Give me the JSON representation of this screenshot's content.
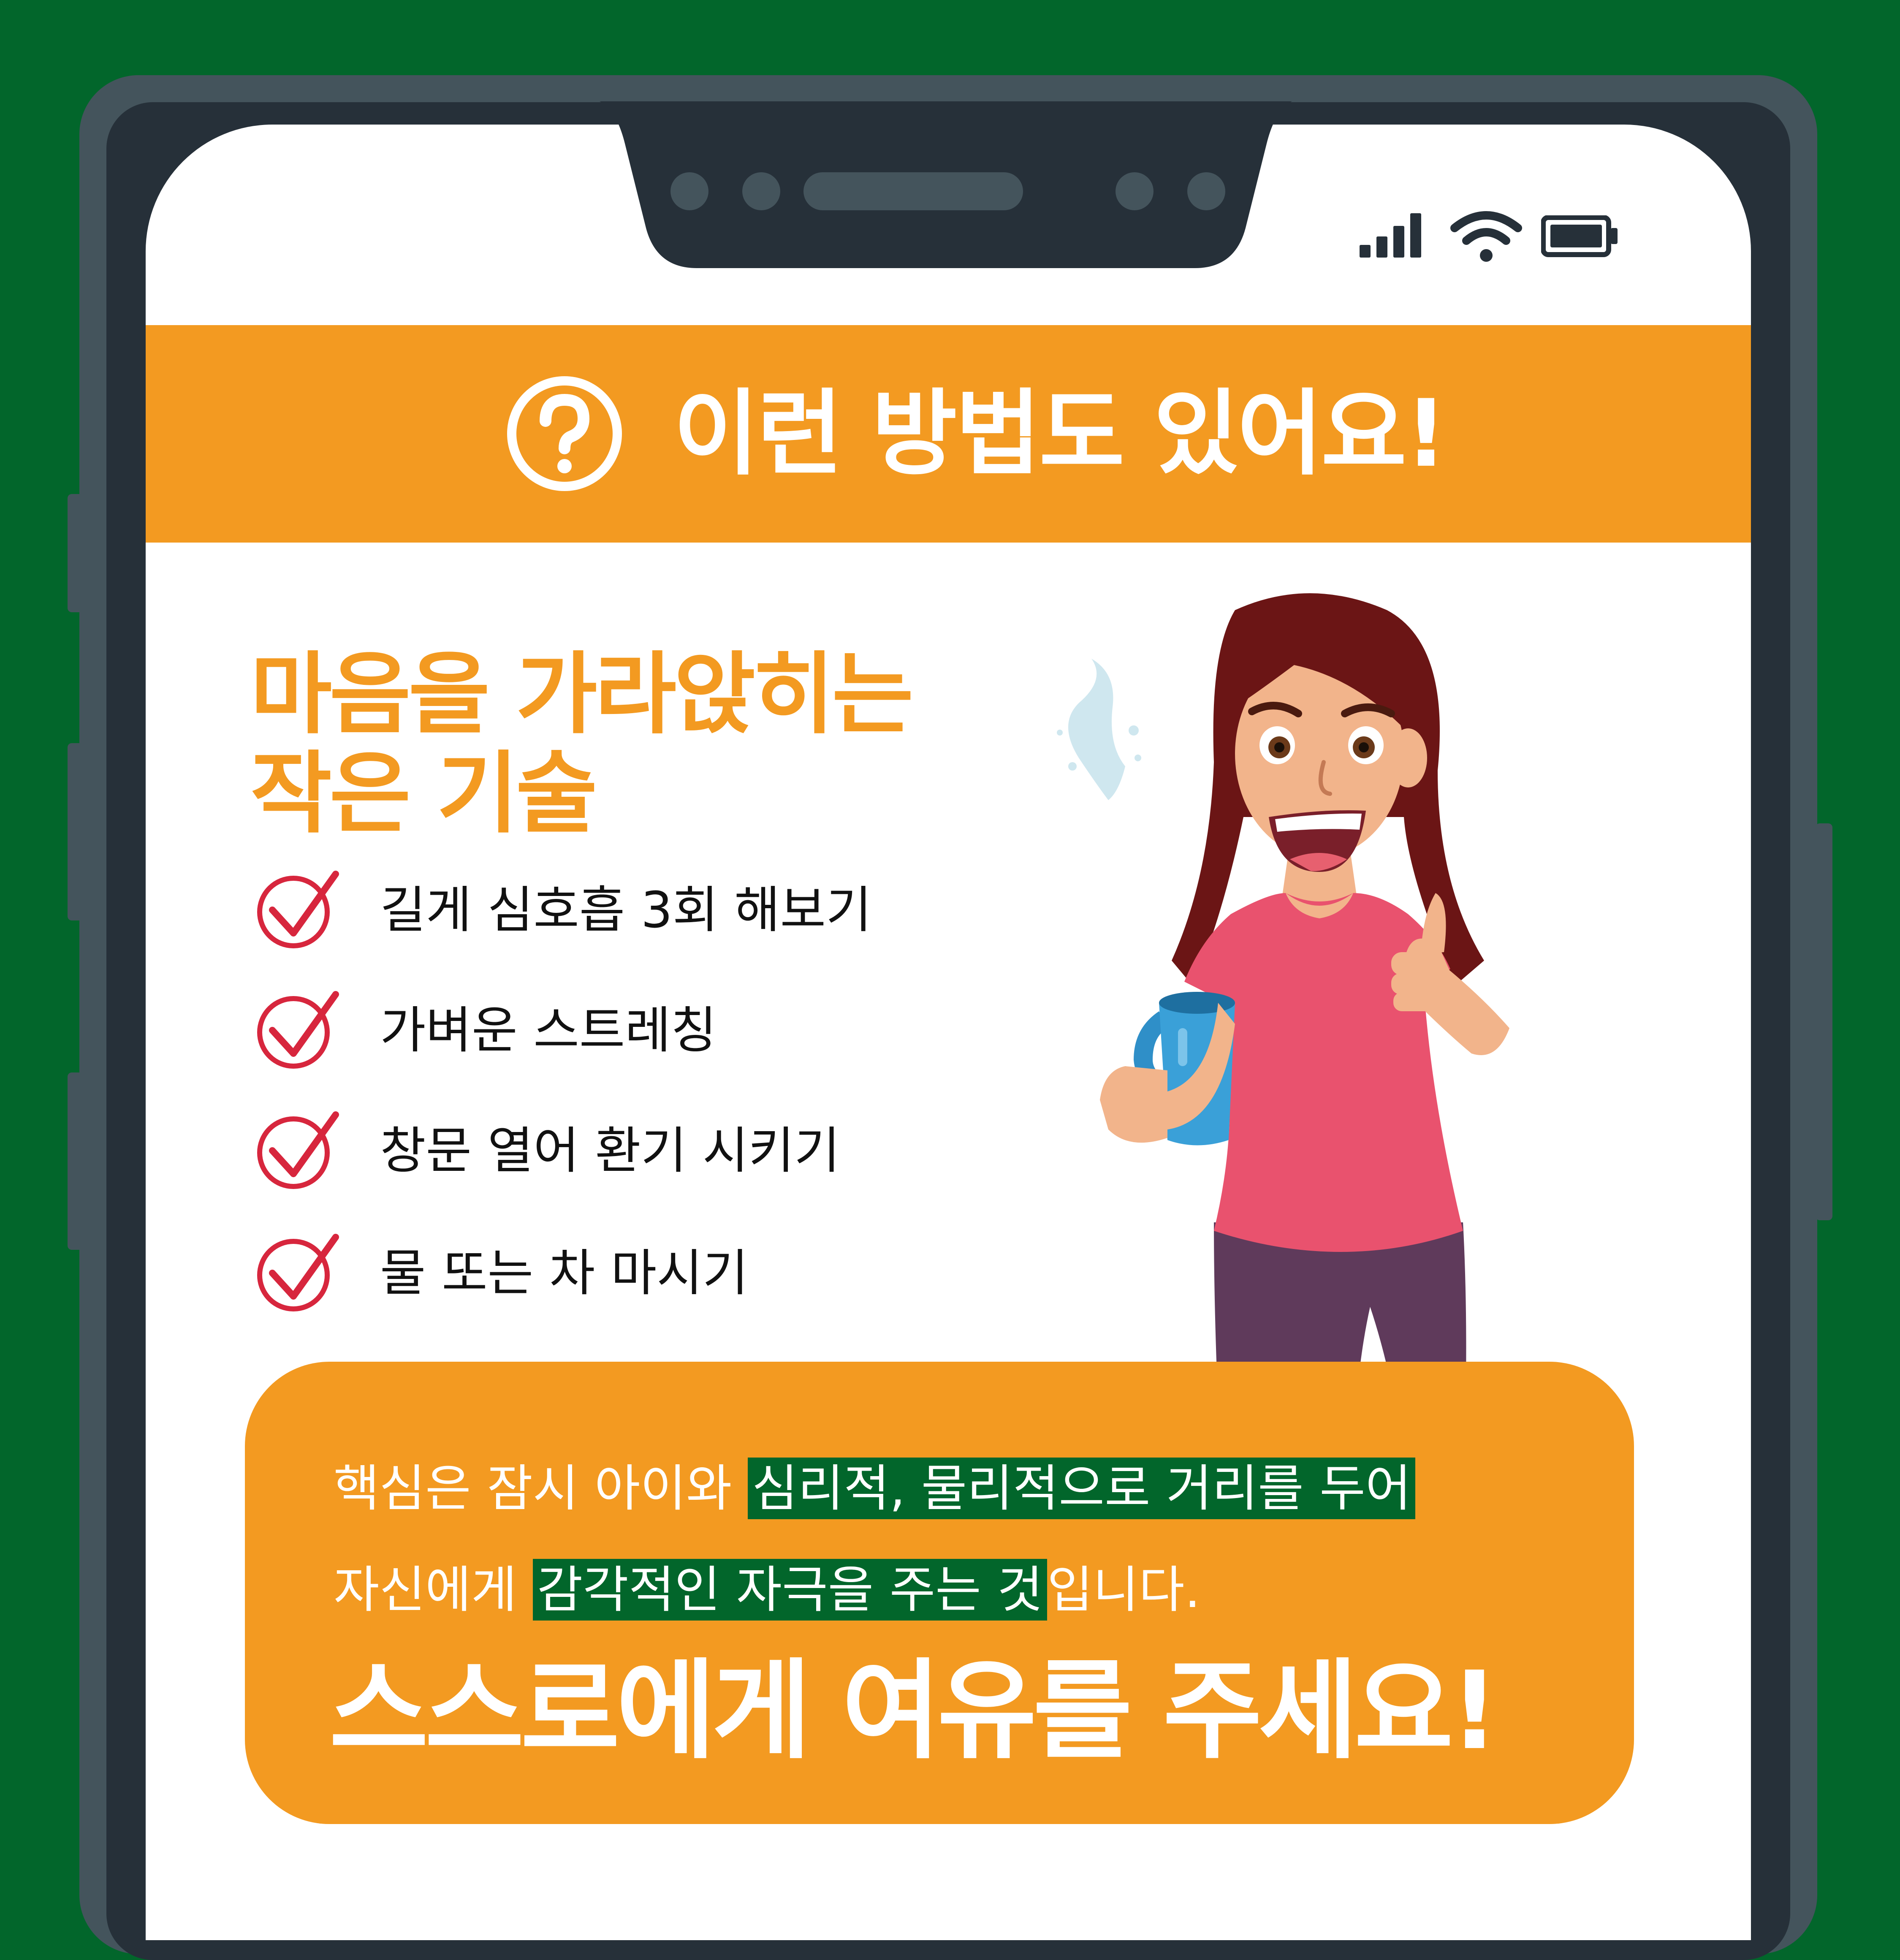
{
  "colors": {
    "background": "#02662b",
    "phone_frame": "#44545c",
    "phone_bezel": "#263039",
    "accent_orange": "#f39a21",
    "highlight_green": "#02662b",
    "check_red": "#d7263d"
  },
  "status_bar": {
    "icons": [
      "signal-icon",
      "wifi-icon",
      "battery-icon"
    ]
  },
  "header": {
    "icon": "question-circle-icon",
    "title": "이런 방법도 있어요!"
  },
  "section": {
    "title_line1": "마음을 가라앉히는",
    "title_line2": "작은 기술"
  },
  "checklist": {
    "icon": "check-circle-icon",
    "items": [
      "길게 심호흡 3회 해보기",
      "가벼운 스트레칭",
      "창문 열어 환기 시키기",
      "물 또는 차 마시기"
    ]
  },
  "message": {
    "line1_part1": "핵심은 잠시 아이와 ",
    "line1_highlight": "심리적, 물리적으로 거리를 두어",
    "line2_part1": "자신에게 ",
    "line2_highlight": "감각적인 자극을 주는 것",
    "line2_part2": "입니다.",
    "cta": "스스로에게 여유를 주세요!"
  }
}
